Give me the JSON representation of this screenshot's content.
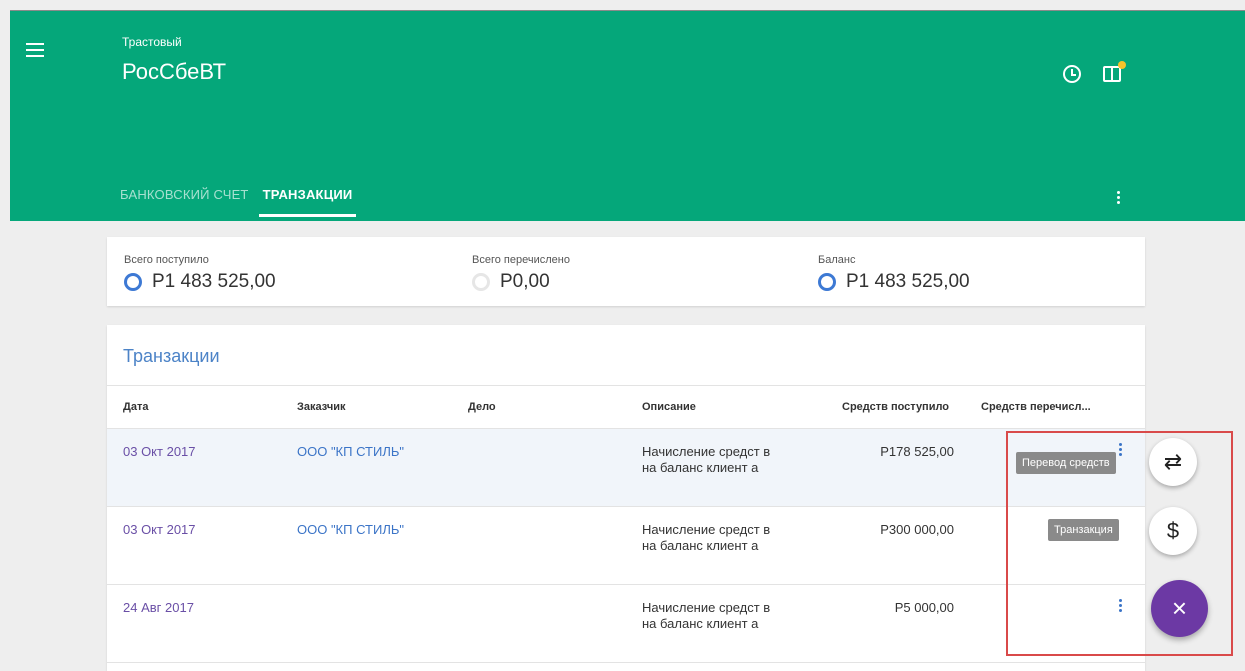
{
  "header": {
    "account_type": "Трастовый",
    "account_name": "РосСбеВТ",
    "tabs": [
      {
        "label": "БАНКОВСКИЙ СЧЕТ",
        "active": false
      },
      {
        "label": "ТРАНЗАКЦИИ",
        "active": true
      }
    ],
    "icons": [
      "menu-icon",
      "history-icon",
      "panel-icon",
      "more-vert-icon"
    ],
    "colors": {
      "header_bg": "#05a77a",
      "badge": "#f6c42a"
    }
  },
  "summary": {
    "received_label": "Всего поступило",
    "received_value": "P1 483 525,00",
    "sent_label": "Всего перечислено",
    "sent_value": "P0,00",
    "balance_label": "Баланс",
    "balance_value": "P1 483 525,00"
  },
  "transactions": {
    "title": "Транзакции",
    "columns": [
      "Дата",
      "Заказчик",
      "Дело",
      "Описание",
      "Средств поступило",
      "Средств перечисл..."
    ],
    "rows": [
      {
        "date": "03 Окт 2017",
        "customer": "ООО \"КП СТИЛЬ\"",
        "case": "",
        "description": "Начисление средст в на баланс клиент а",
        "received": "P178 525,00",
        "sent": ""
      },
      {
        "date": "03 Окт 2017",
        "customer": "ООО \"КП СТИЛЬ\"",
        "case": "",
        "description": "Начисление средст в на баланс клиент а",
        "received": "P300 000,00",
        "sent": ""
      },
      {
        "date": "24 Авг 2017",
        "customer": "",
        "case": "",
        "description": "Начисление средст в на баланс клиент а",
        "received": "P5 000,00",
        "sent": ""
      }
    ]
  },
  "fab": {
    "transfer_tooltip": "Перевод средств",
    "transaction_tooltip": "Транзакция",
    "transfer_icon": "⇄",
    "transaction_icon": "$",
    "close_icon": "×",
    "main_color": "#6c39a4"
  }
}
